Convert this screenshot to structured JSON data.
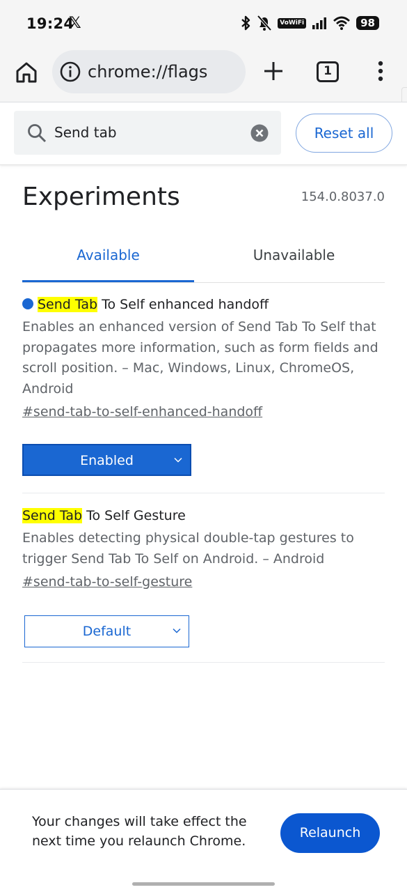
{
  "status_bar": {
    "time": "19:24",
    "x_logo": "𝕏",
    "wifi_calling": "VoWiFi",
    "battery": "98",
    "icons": [
      "bluetooth-icon",
      "bell-off-icon",
      "vowifi-icon",
      "signal-icon",
      "wifi-icon",
      "battery-icon"
    ]
  },
  "toolbar": {
    "url": "chrome://flags",
    "tab_count": "1",
    "icons": [
      "home-icon",
      "info-icon",
      "plus-icon",
      "tab-switcher-icon",
      "more-vert-icon"
    ]
  },
  "search": {
    "value": "Send tab",
    "reset_label": "Reset all"
  },
  "page": {
    "title": "Experiments",
    "version": "154.0.8037.0",
    "tabs": [
      {
        "label": "Available",
        "selected": true
      },
      {
        "label": "Unavailable",
        "selected": false
      }
    ]
  },
  "flags": [
    {
      "title_highlight": "Send Tab",
      "title_rest": " To Self enhanced handoff",
      "modified": true,
      "description": "Enables an enhanced version of Send Tab To Self that propagates more information, such as form fields and scroll position. – Mac, Windows, Linux, ChromeOS, Android",
      "link": "#send-tab-to-self-enhanced-handoff",
      "state": "Enabled"
    },
    {
      "title_highlight": "Send Tab",
      "title_rest": " To Self Gesture",
      "modified": false,
      "description": "Enables detecting physical double-tap gestures to trigger Send Tab To Self on Android. – Android",
      "link": "#send-tab-to-self-gesture",
      "state": "Default"
    }
  ],
  "bottom_bar": {
    "message": "Your changes will take effect the next time you relaunch Chrome.",
    "relaunch_label": "Relaunch"
  },
  "colors": {
    "accent": "#1a67d2",
    "highlight": "#ffff00",
    "relaunch_bg": "#0b57d0"
  }
}
